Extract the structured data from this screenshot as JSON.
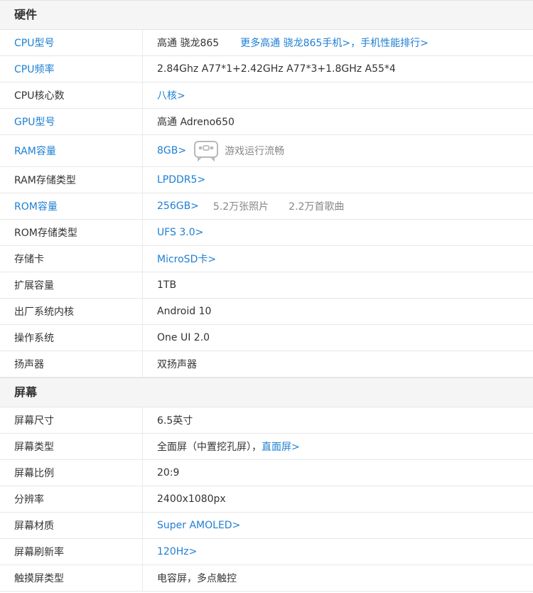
{
  "colors": {
    "link": "#1e7fd4",
    "header_bg": "#f5f5f5",
    "border": "#e8e8e8",
    "muted": "#888888"
  },
  "hardware": {
    "title": "硬件",
    "cpu_model_label": "CPU型号",
    "cpu_model_value": "高通 骁龙865",
    "cpu_model_more": "更多高通 骁龙865手机>",
    "cpu_model_sep": "，",
    "cpu_model_rank": "手机性能排行>",
    "cpu_freq_label": "CPU频率",
    "cpu_freq_value": "2.84Ghz A77*1+2.42GHz A77*3+1.8GHz A55*4",
    "cpu_cores_label": "CPU核心数",
    "cpu_cores_value": "八核>",
    "gpu_label": "GPU型号",
    "gpu_value": "高通 Adreno650",
    "ram_label": "RAM容量",
    "ram_value": "8GB>",
    "ram_game_icon": "gamepad-icon",
    "ram_note": "游戏运行流畅",
    "ram_type_label": "RAM存储类型",
    "ram_type_value": "LPDDR5>",
    "rom_label": "ROM容量",
    "rom_value": "256GB>",
    "rom_photos": "5.2万张照片",
    "rom_songs": "2.2万首歌曲",
    "rom_type_label": "ROM存储类型",
    "rom_type_value": "UFS 3.0>",
    "sd_label": "存储卡",
    "sd_value": "MicroSD卡>",
    "expand_label": "扩展容量",
    "expand_value": "1TB",
    "kernel_label": "出厂系统内核",
    "kernel_value": "Android 10",
    "os_label": "操作系统",
    "os_value": "One UI 2.0",
    "speaker_label": "扬声器",
    "speaker_value": "双扬声器"
  },
  "screen": {
    "title": "屏幕",
    "size_label": "屏幕尺寸",
    "size_value": "6.5英寸",
    "type_label": "屏幕类型",
    "type_value": "全面屏（中置挖孔屏），",
    "type_link": "直面屏>",
    "ratio_label": "屏幕比例",
    "ratio_value": "20:9",
    "resolution_label": "分辨率",
    "resolution_value": "2400x1080px",
    "material_label": "屏幕材质",
    "material_value": "Super AMOLED>",
    "refresh_label": "屏幕刷新率",
    "refresh_value": "120Hz>",
    "touch_label": "触摸屏类型",
    "touch_value": "电容屏，多点触控"
  }
}
